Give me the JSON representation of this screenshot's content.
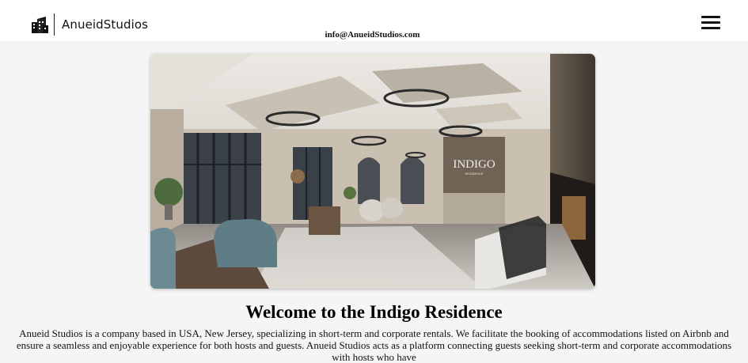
{
  "header": {
    "brand_name": "AnueidStudios",
    "email": "info@AnueidStudios.com",
    "logo_icon": "building-logo-icon",
    "menu_icon": "hamburger-menu-icon"
  },
  "hero": {
    "image_sign_text": "INDIGO",
    "image_sign_subtext": "RESIDENCE"
  },
  "main": {
    "title": "Welcome to the Indigo Residence",
    "intro": "Anueid Studios is a company based in USA, New Jersey, specializing in short-term and corporate rentals. We facilitate the booking of accommodations listed on Airbnb and ensure a seamless and enjoyable experience for both hosts and guests. Anueid Studios acts as a platform connecting guests seeking short-term and corporate accommodations with hosts who have"
  },
  "colors": {
    "page_background": "#f5f5f5",
    "header_background": "#ffffff",
    "text": "#111111"
  }
}
